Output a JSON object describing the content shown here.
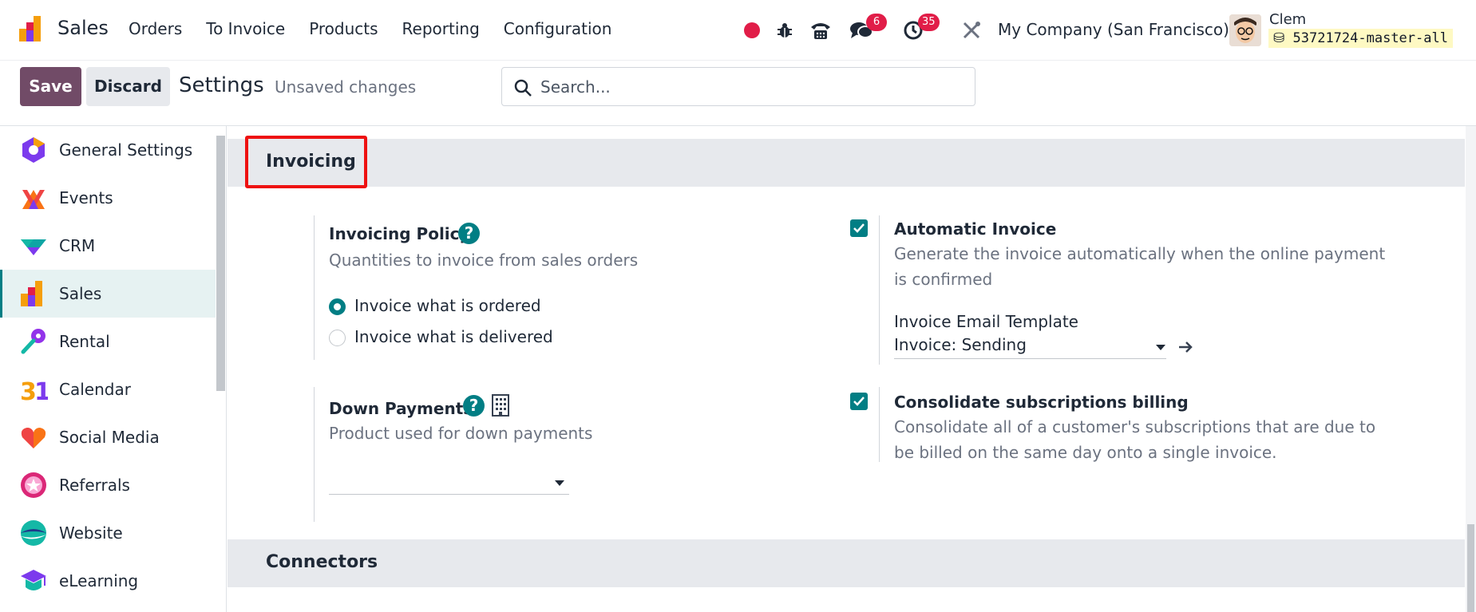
{
  "navbar": {
    "app_name": "Sales",
    "menu": [
      "Orders",
      "To Invoice",
      "Products",
      "Reporting",
      "Configuration"
    ],
    "chat_count": "6",
    "activity_count": "35",
    "company": "My Company (San Francisco)",
    "user_name": "Clem",
    "database": "53721724-master-all"
  },
  "control_panel": {
    "save_label": "Save",
    "discard_label": "Discard",
    "title": "Settings",
    "status": "Unsaved changes",
    "search_placeholder": "Search..."
  },
  "sidebar": {
    "items": [
      {
        "label": "General Settings",
        "icon": "general-settings-icon"
      },
      {
        "label": "Events",
        "icon": "events-icon"
      },
      {
        "label": "CRM",
        "icon": "crm-icon"
      },
      {
        "label": "Sales",
        "icon": "sales-icon",
        "active": true
      },
      {
        "label": "Rental",
        "icon": "rental-icon"
      },
      {
        "label": "Calendar",
        "icon": "calendar-icon"
      },
      {
        "label": "Social Media",
        "icon": "social-media-icon"
      },
      {
        "label": "Referrals",
        "icon": "referrals-icon"
      },
      {
        "label": "Website",
        "icon": "website-icon"
      },
      {
        "label": "eLearning",
        "icon": "elearning-icon"
      }
    ]
  },
  "invoicing": {
    "section_title": "Invoicing",
    "policy": {
      "title": "Invoicing Policy",
      "description": "Quantities to invoice from sales orders",
      "options": [
        "Invoice what is ordered",
        "Invoice what is delivered"
      ],
      "selected": 0
    },
    "down_payments": {
      "title": "Down Payments",
      "description": "Product used for down payments",
      "value": ""
    },
    "automatic_invoice": {
      "title": "Automatic Invoice",
      "description": "Generate the invoice automatically when the online payment is confirmed",
      "checked": true,
      "template_label": "Invoice Email Template",
      "template_value": "Invoice: Sending"
    },
    "consolidate": {
      "title": "Consolidate subscriptions billing",
      "description": "Consolidate all of a customer's subscriptions that are due to be billed on the same day onto a single invoice.",
      "checked": true
    }
  },
  "connectors": {
    "section_title": "Connectors"
  },
  "colors": {
    "brand": "#714b67",
    "accent": "#017e84",
    "badge": "#e11d48",
    "highlight": "#ee1111"
  }
}
